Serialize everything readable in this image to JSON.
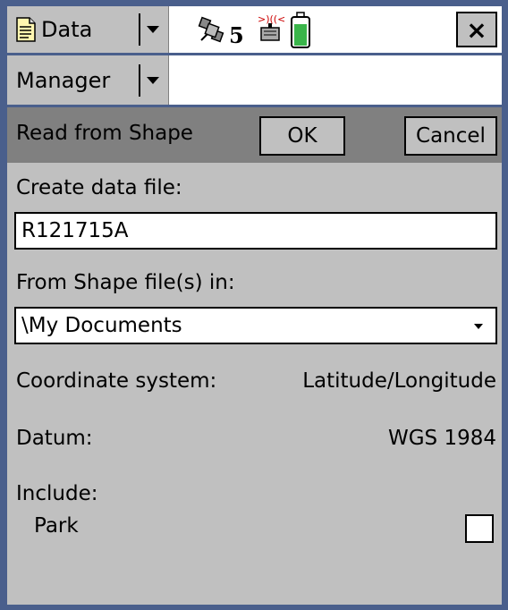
{
  "topbar": {
    "app_menu_label": "Data",
    "satellite_count": "5",
    "close_label": "×"
  },
  "nav": {
    "section_label": "Manager"
  },
  "dialog": {
    "title": "Read from Shape",
    "ok_label": "OK",
    "cancel_label": "Cancel"
  },
  "form": {
    "create_label": "Create data file:",
    "create_value": "R121715A",
    "from_label": "From Shape file(s) in:",
    "from_value": "\\My Documents",
    "coord_label": "Coordinate system:",
    "coord_value": "Latitude/Longitude",
    "datum_label": "Datum:",
    "datum_value": "WGS 1984",
    "include_label": "Include:",
    "park_label": "Park",
    "park_checked": false
  },
  "colors": {
    "frame": "#4a5f8c",
    "panel": "#c0c0c0",
    "header": "#808080",
    "battery_green": "#3ab54a"
  }
}
